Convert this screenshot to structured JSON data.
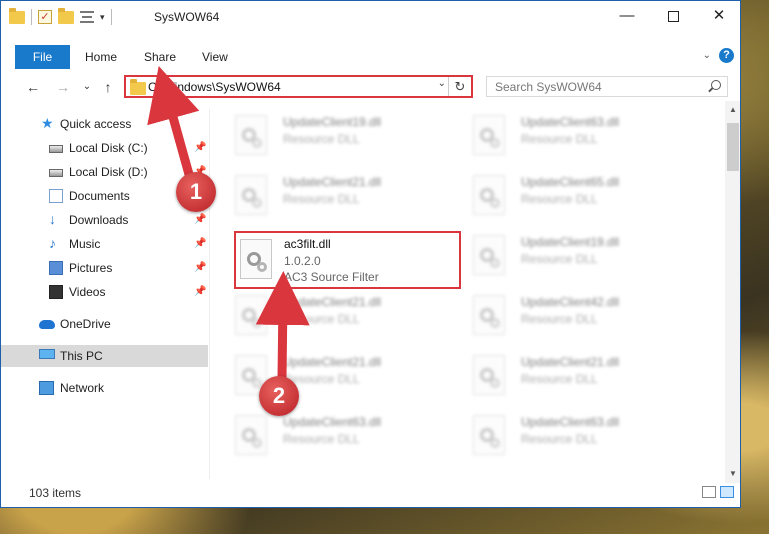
{
  "window": {
    "title": "SysWOW64",
    "buttons": {
      "minimize": "—",
      "maximize": "",
      "close": "✕"
    }
  },
  "ribbon": {
    "file": "File",
    "tabs": [
      "Home",
      "Share",
      "View"
    ],
    "help": "?"
  },
  "nav": {
    "back": "←",
    "forward": "→",
    "recent": "⌄",
    "up": "↑",
    "address": "C:\\Windows\\SysWOW64",
    "refresh": "↻",
    "search_placeholder": "Search SysWOW64"
  },
  "sidebar": {
    "items": [
      {
        "label": "Quick access",
        "icon": "star-icon",
        "pinned": false
      },
      {
        "label": "Local Disk (C:)",
        "icon": "disk-icon",
        "pinned": true
      },
      {
        "label": "Local Disk (D:)",
        "icon": "disk-icon",
        "pinned": true
      },
      {
        "label": "Documents",
        "icon": "documents-icon",
        "pinned": true
      },
      {
        "label": "Downloads",
        "icon": "downloads-icon",
        "pinned": true
      },
      {
        "label": "Music",
        "icon": "music-icon",
        "pinned": true
      },
      {
        "label": "Pictures",
        "icon": "pictures-icon",
        "pinned": true
      },
      {
        "label": "Videos",
        "icon": "videos-icon",
        "pinned": true
      },
      {
        "label": "OneDrive",
        "icon": "onedrive-icon",
        "pinned": false
      },
      {
        "label": "This PC",
        "icon": "pc-icon",
        "pinned": false,
        "selected": true
      },
      {
        "label": "Network",
        "icon": "network-icon",
        "pinned": false
      }
    ]
  },
  "files": [
    {
      "name": "UpdateClient19.dll",
      "line1": "Resource DLL",
      "line2": ""
    },
    {
      "name": "UpdateClient63.dll",
      "line1": "Resource DLL",
      "line2": ""
    },
    {
      "name": "UpdateClient21.dll",
      "line1": "Resource DLL",
      "line2": ""
    },
    {
      "name": "UpdateClient65.dll",
      "line1": "Resource DLL",
      "line2": ""
    },
    {
      "name": "ac3filt.dll",
      "line1": "1.0.2.0",
      "line2": "AC3 Source Filter",
      "highlighted": true
    },
    {
      "name": "UpdateClient19.dll",
      "line1": "Resource DLL",
      "line2": ""
    },
    {
      "name": "UpdateClient21.dll",
      "line1": "Resource DLL",
      "line2": ""
    },
    {
      "name": "UpdateClient42.dll",
      "line1": "Resource DLL",
      "line2": ""
    },
    {
      "name": "UpdateClient21.dll",
      "line1": "Resource DLL",
      "line2": ""
    },
    {
      "name": "UpdateClient21.dll",
      "line1": "Resource DLL",
      "line2": ""
    },
    {
      "name": "UpdateClient63.dll",
      "line1": "Resource DLL",
      "line2": ""
    },
    {
      "name": "UpdateClient63.dll",
      "line1": "Resource DLL",
      "line2": ""
    }
  ],
  "status": {
    "item_count": "103 items"
  },
  "annotations": {
    "step1": "1",
    "step2": "2",
    "color": "#d9363e"
  }
}
